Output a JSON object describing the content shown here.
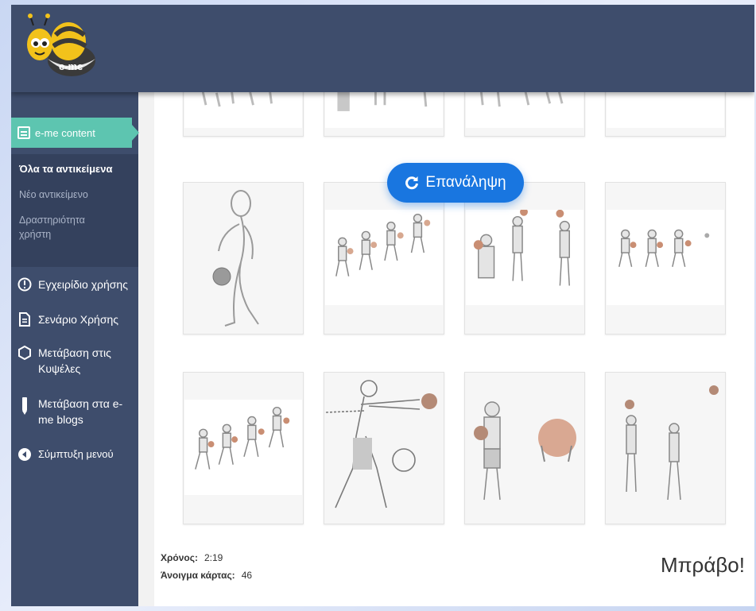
{
  "app": {
    "logo_text": "e-me"
  },
  "sidebar": {
    "active_item": {
      "label": "e-me content",
      "icon": "table-icon"
    },
    "sub_items": [
      {
        "label": "Όλα τα αντικείμενα",
        "active": true
      },
      {
        "label": "Νέο αντικείμενο",
        "active": false
      },
      {
        "label": "Δραστηριότητα χρήστη",
        "active": false
      }
    ],
    "menu_items": [
      {
        "label": "Εγχειρίδιο χρήσης",
        "icon": "info-circle-icon"
      },
      {
        "label": "Σενάριο Χρήσης",
        "icon": "document-icon"
      },
      {
        "label": "Μετάβαση στις Κυψέλες",
        "icon": "hexagon-icon"
      },
      {
        "label": "Μετάβαση στα e-me blogs",
        "icon": "pen-icon"
      },
      {
        "label": "Σύμπτυξη μενού",
        "icon": "collapse-left-icon"
      }
    ]
  },
  "game": {
    "replay_label": "Επανάληψη",
    "time_label": "Χρόνος:",
    "time_value": "2:19",
    "flips_label": "Άνοιγμα κάρτας:",
    "flips_value": "46",
    "result_message": "Μπράβο!"
  },
  "colors": {
    "header_bg": "#3e4d6c",
    "sidebar_active": "#5dc5b0",
    "replay_button": "#1976e0"
  }
}
